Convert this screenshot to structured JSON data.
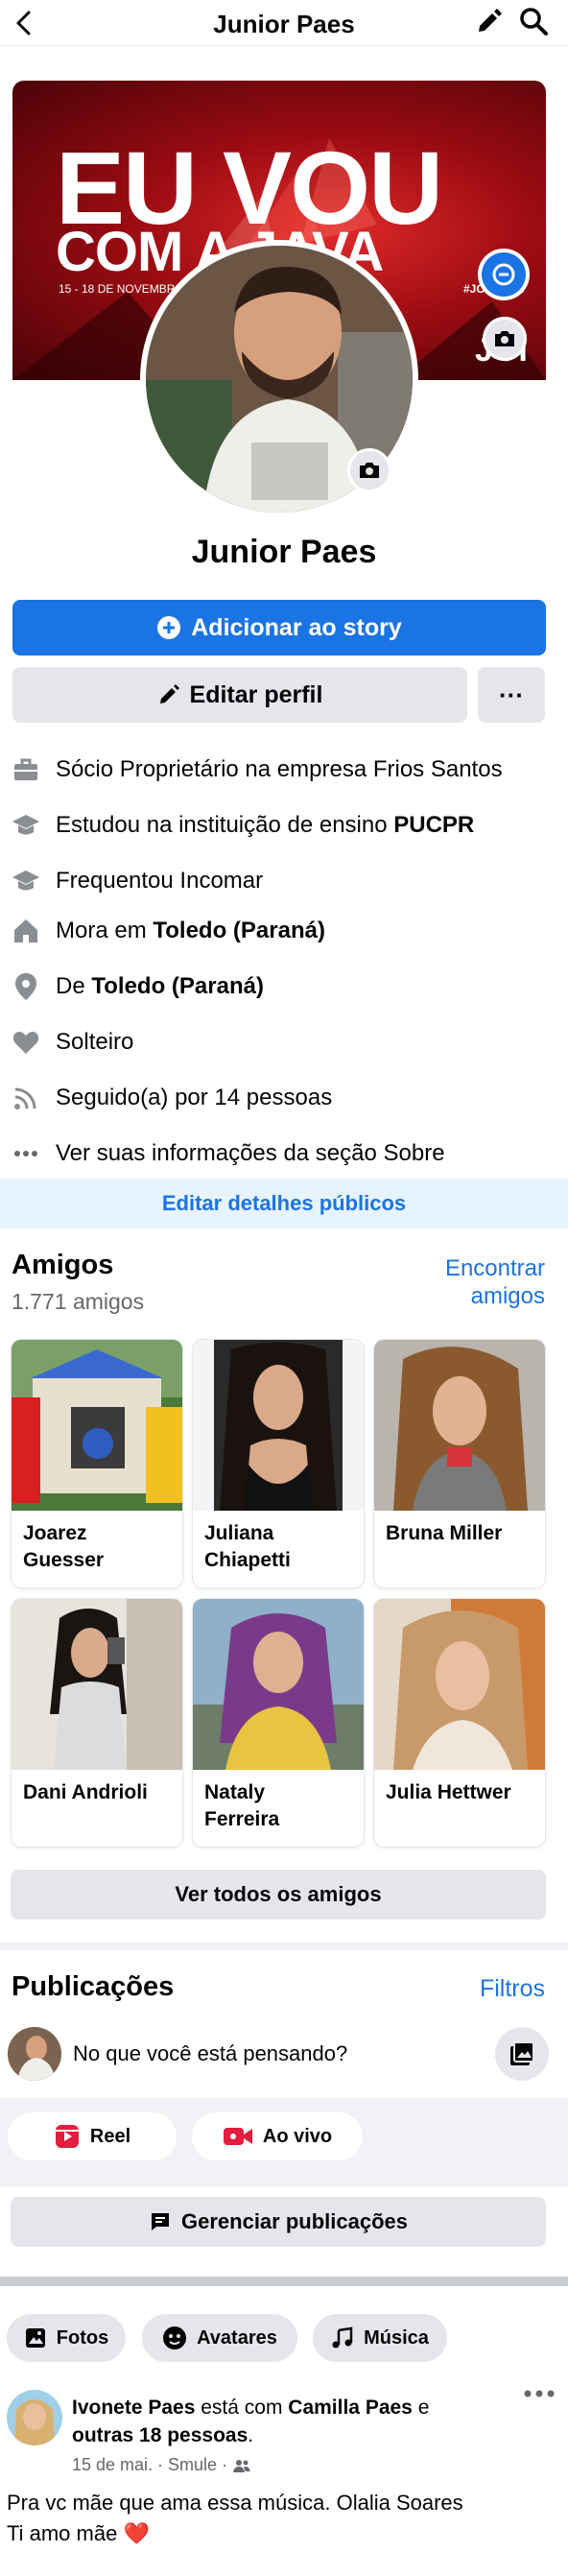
{
  "header": {
    "title": "Junior Paes"
  },
  "cover": {
    "line1": "EU VOU",
    "line2": "COM A   JAVA",
    "date": "15 - 18 DE NOVEMBRO",
    "hashtag": "#JOIA2K18",
    "mark": "JOI"
  },
  "profile": {
    "name": "Junior Paes",
    "add_story": "Adicionar ao story",
    "edit_profile": "Editar perfil",
    "more": "···"
  },
  "intro": {
    "work_prefix": "Sócio Proprietário na empresa ",
    "work_place": "Frios Santos",
    "study_prefix": "Estudou na instituição de ensino ",
    "study_place": "PUCPR",
    "frequented": "Frequentou Incomar",
    "lives_prefix": "Mora em ",
    "lives_place": "Toledo (Paraná)",
    "from_prefix": "De ",
    "from_place": "Toledo (Paraná)",
    "relationship": "Solteiro",
    "followers": "Seguido(a) por 14 pessoas",
    "see_about": "Ver suas informações da seção Sobre",
    "edit_public": "Editar detalhes públicos"
  },
  "friends": {
    "title": "Amigos",
    "count": "1.771 amigos",
    "find_line1": "Encontrar",
    "find_line2": "amigos",
    "items": [
      {
        "name_line1": "Joarez",
        "name_line2": "Guesser"
      },
      {
        "name_line1": "Juliana",
        "name_line2": "Chiapetti"
      },
      {
        "name_line1": "Bruna Miller",
        "name_line2": ""
      },
      {
        "name_line1": "Dani Andrioli",
        "name_line2": ""
      },
      {
        "name_line1": "Nataly",
        "name_line2": "Ferreira"
      },
      {
        "name_line1": "Julia Hettwer",
        "name_line2": ""
      }
    ],
    "see_all": "Ver todos os amigos"
  },
  "posts": {
    "title": "Publicações",
    "filters": "Filtros",
    "composer_placeholder": "No que você está pensando?",
    "reel": "Reel",
    "live": "Ao vivo",
    "manage": "Gerenciar publicações",
    "tabs": [
      "Fotos",
      "Avatares",
      "Música"
    ]
  },
  "post": {
    "author": "Ivonete Paes",
    "with_text": " está com ",
    "tagged": "Camilla Paes",
    "and_text": " e",
    "others": "outras 18 pessoas",
    "period": ".",
    "meta": "15 de mai. · Smule ·",
    "text_line1": "Pra vc mãe que ama essa música. Olalia Soares",
    "text_line2": "Ti amo mãe ❤️"
  },
  "colors": {
    "accent": "#1b74e4",
    "button_gray": "#e4e6eb",
    "text_secondary": "#65676b"
  }
}
